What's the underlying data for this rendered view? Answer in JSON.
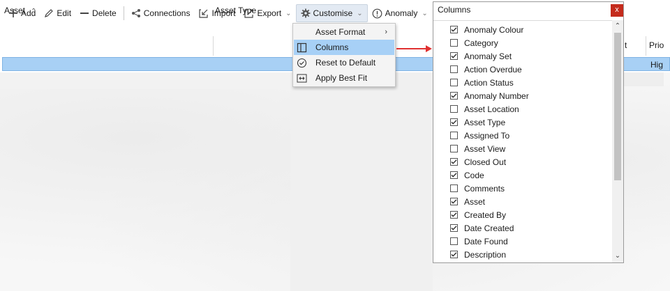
{
  "toolbar": {
    "add": "Add",
    "edit": "Edit",
    "delete": "Delete",
    "connections": "Connections",
    "import": "Import",
    "export": "Export",
    "customise": "Customise",
    "anomaly": "Anomaly"
  },
  "grid": {
    "col_asset": "Asset",
    "col_asset_type": "Asset Type",
    "col_t": "t",
    "col_prio": "Prio",
    "selected_prio": "Hig"
  },
  "menu": {
    "items": [
      {
        "label": "Asset Format",
        "icon": "none"
      },
      {
        "label": "Columns",
        "icon": "columns-icon"
      },
      {
        "label": "Reset to Default",
        "icon": "reset-icon"
      },
      {
        "label": "Apply Best Fit",
        "icon": "best-fit-icon"
      }
    ]
  },
  "columns_panel": {
    "title": "Columns",
    "close": "x",
    "items": [
      {
        "label": "Anomaly Colour",
        "checked": true
      },
      {
        "label": "Category",
        "checked": false
      },
      {
        "label": "Anomaly Set",
        "checked": true
      },
      {
        "label": "Action Overdue",
        "checked": false
      },
      {
        "label": "Action Status",
        "checked": false
      },
      {
        "label": "Anomaly Number",
        "checked": true
      },
      {
        "label": "Asset Location",
        "checked": false
      },
      {
        "label": "Asset Type",
        "checked": true
      },
      {
        "label": "Assigned To",
        "checked": false
      },
      {
        "label": "Asset View",
        "checked": false
      },
      {
        "label": "Closed Out",
        "checked": true
      },
      {
        "label": "Code",
        "checked": true
      },
      {
        "label": "Comments",
        "checked": false
      },
      {
        "label": "Asset",
        "checked": true
      },
      {
        "label": "Created By",
        "checked": true
      },
      {
        "label": "Date Created",
        "checked": true
      },
      {
        "label": "Date Found",
        "checked": false
      },
      {
        "label": "Description",
        "checked": true
      }
    ]
  },
  "colors": {
    "selection": "#a7d0f6",
    "arrow": "#e03030",
    "close": "#c42b1c"
  }
}
